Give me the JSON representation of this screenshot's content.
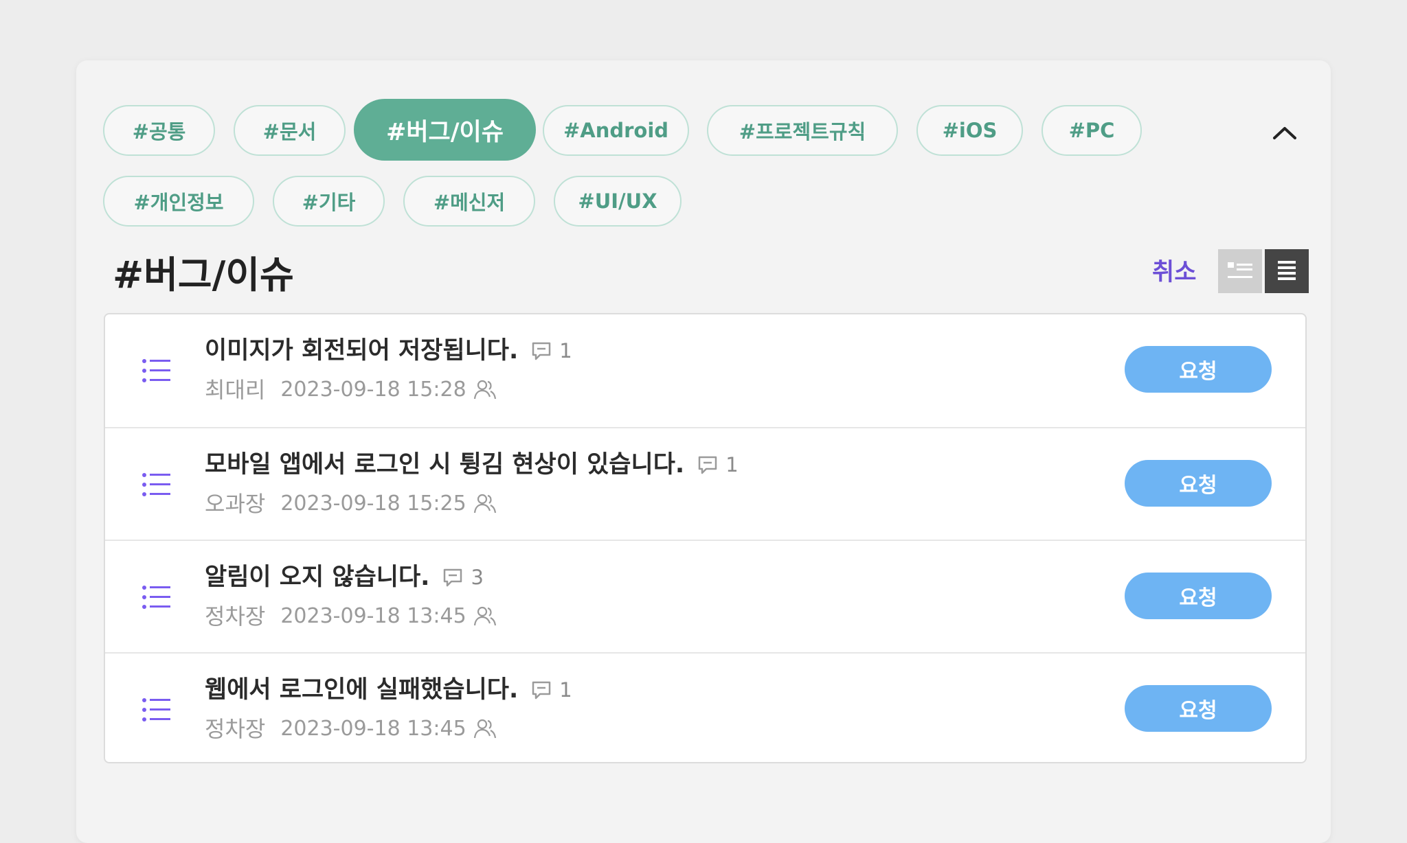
{
  "tags": [
    {
      "label": "#공통",
      "active": false
    },
    {
      "label": "#문서",
      "active": false
    },
    {
      "label": "#버그/이슈",
      "active": true
    },
    {
      "label": "#Android",
      "active": false
    },
    {
      "label": "#프로젝트규칙",
      "active": false
    },
    {
      "label": "#iOS",
      "active": false
    },
    {
      "label": "#PC",
      "active": false
    },
    {
      "label": "#개인정보",
      "active": false
    },
    {
      "label": "#기타",
      "active": false
    },
    {
      "label": "#메신저",
      "active": false
    },
    {
      "label": "#UI/UX",
      "active": false
    }
  ],
  "section": {
    "title": "#버그/이슈",
    "cancel_label": "취소"
  },
  "posts": [
    {
      "title": "이미지가 회전되어 저장됩니다.",
      "comments": "1",
      "author": "최대리",
      "date": "2023-09-18 15:28",
      "action": "요청"
    },
    {
      "title": "모바일 앱에서 로그인 시 튕김 현상이 있습니다.",
      "comments": "1",
      "author": "오과장",
      "date": "2023-09-18 15:25",
      "action": "요청"
    },
    {
      "title": "알림이 오지 않습니다.",
      "comments": "3",
      "author": "정차장",
      "date": "2023-09-18 13:45",
      "action": "요청"
    },
    {
      "title": "웹에서 로그인에 실패했습니다.",
      "comments": "1",
      "author": "정차장",
      "date": "2023-09-18 13:45",
      "action": "요청"
    }
  ],
  "icons": {
    "collapse": "chevron-up-icon",
    "card_view": "card-view-icon",
    "list_view": "list-view-icon",
    "post": "list-icon",
    "comment": "comment-icon",
    "viewer": "users-icon"
  },
  "colors": {
    "tag_border": "#bfe1d6",
    "tag_text": "#4f9d86",
    "tag_active_bg": "#5fae95",
    "accent_purple": "#6c4fd6",
    "request_button": "#6eb4f3"
  }
}
